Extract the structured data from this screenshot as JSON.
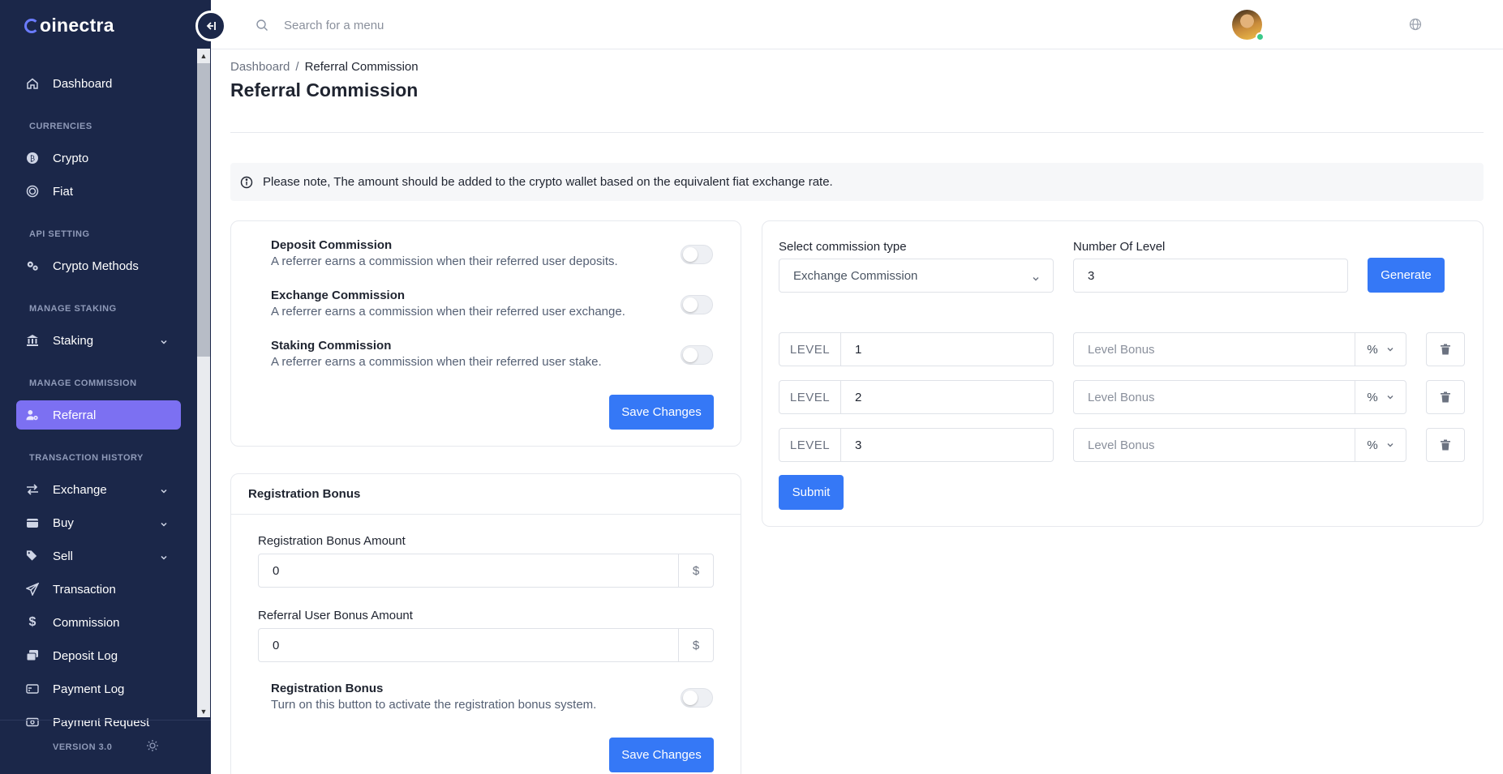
{
  "brand": {
    "name": "oinectra",
    "version": "VERSION 3.0"
  },
  "sidebar": {
    "dashboard": "Dashboard",
    "headings": {
      "currencies": "CURRENCIES",
      "api_setting": "API SETTING",
      "manage_staking": "MANAGE STAKING",
      "manage_commission": "MANAGE COMMISSION",
      "transaction_history": "TRANSACTION HISTORY"
    },
    "items": {
      "crypto": "Crypto",
      "fiat": "Fiat",
      "crypto_methods": "Crypto Methods",
      "staking": "Staking",
      "referral": "Referral",
      "exchange": "Exchange",
      "buy": "Buy",
      "sell": "Sell",
      "transaction": "Transaction",
      "commission": "Commission",
      "deposit_log": "Deposit Log",
      "payment_log": "Payment Log",
      "payment_request": "Payment Request"
    },
    "active": "referral"
  },
  "topbar": {
    "search_placeholder": "Search for a menu"
  },
  "breadcrumb": {
    "root": "Dashboard",
    "separator": "/",
    "current": "Referral Commission"
  },
  "page_title": "Referral Commission",
  "notice": "Please note, The amount should be added to the crypto wallet based on the equivalent fiat exchange rate.",
  "commission_toggles": [
    {
      "title": "Deposit Commission",
      "desc": "A referrer earns a commission when their referred user deposits.",
      "enabled": false
    },
    {
      "title": "Exchange Commission",
      "desc": "A referrer earns a commission when their referred user exchange.",
      "enabled": false
    },
    {
      "title": "Staking Commission",
      "desc": "A referrer earns a commission when their referred user stake.",
      "enabled": false
    }
  ],
  "save_label": "Save Changes",
  "registration": {
    "header": "Registration Bonus",
    "bonus_amount_label": "Registration Bonus Amount",
    "bonus_amount_value": "0",
    "referral_bonus_label": "Referral User Bonus Amount",
    "referral_bonus_value": "0",
    "currency_symbol": "$",
    "toggle_title": "Registration Bonus",
    "toggle_desc": "Turn on this button to activate the registration bonus system.",
    "toggle_enabled": false
  },
  "levels_form": {
    "type_label": "Select commission type",
    "type_value": "Exchange Commission",
    "count_label": "Number Of Level",
    "count_value": "3",
    "generate_label": "Generate",
    "level_prefix": "LEVEL",
    "bonus_placeholder": "Level Bonus",
    "unit": "%",
    "levels": [
      "1",
      "2",
      "3"
    ],
    "submit_label": "Submit"
  },
  "colors": {
    "sidebar_bg": "#1b2749",
    "active_item": "#7c70f2",
    "primary": "#3578f6"
  }
}
